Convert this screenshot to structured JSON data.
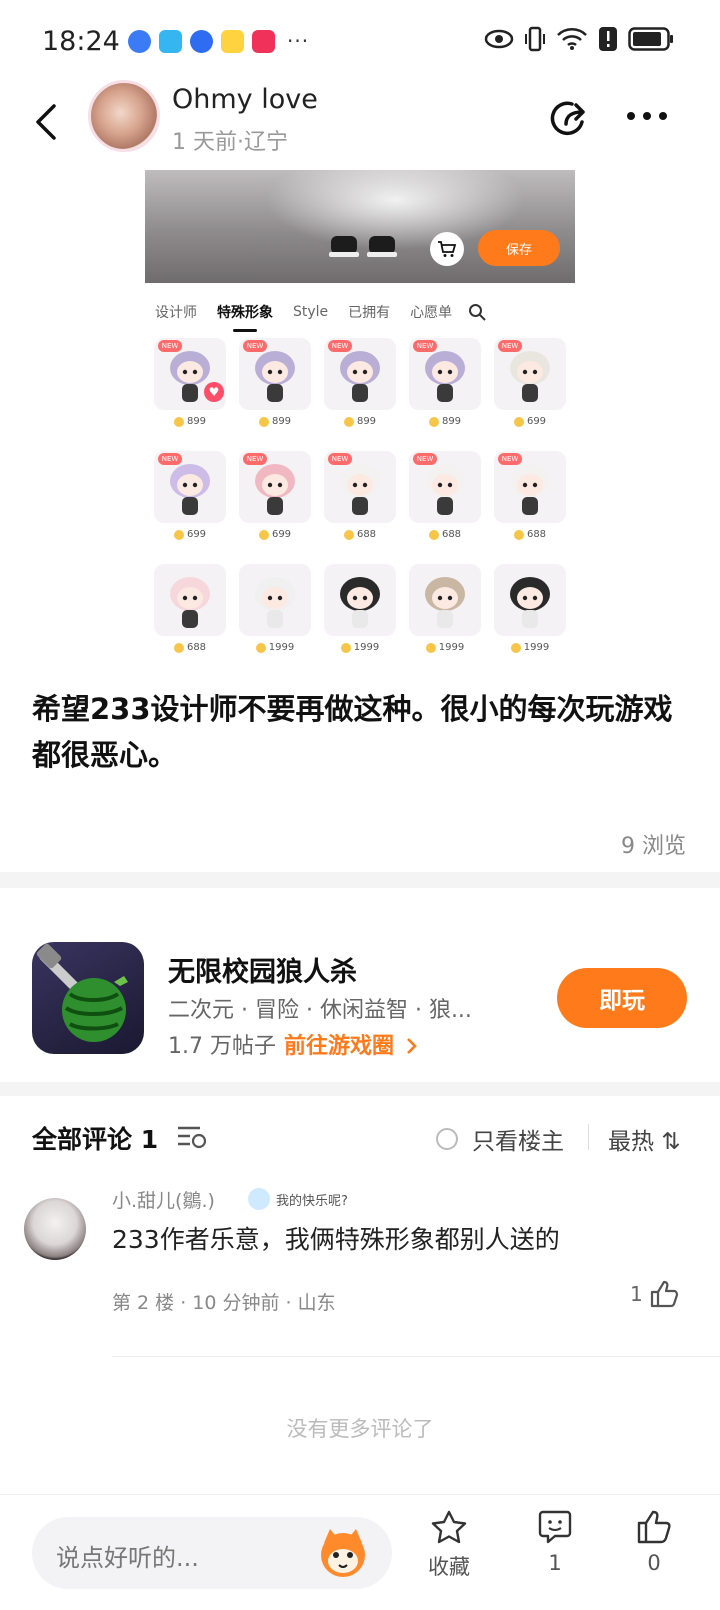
{
  "status_bar": {
    "time": "18:24",
    "more": "···"
  },
  "header": {
    "username": "Ohmy love",
    "meta": "1 天前·辽宁"
  },
  "post_image": {
    "save_label": "保存",
    "tabs": [
      "设计师",
      "特殊形象",
      "Style",
      "已拥有",
      "心愿单"
    ],
    "new_tag": "NEW",
    "items": [
      {
        "price": "899",
        "is_new": true
      },
      {
        "price": "899",
        "is_new": true
      },
      {
        "price": "899",
        "is_new": true
      },
      {
        "price": "899",
        "is_new": true
      },
      {
        "price": "699",
        "is_new": true
      },
      {
        "price": "699",
        "is_new": true
      },
      {
        "price": "699",
        "is_new": true
      },
      {
        "price": "688",
        "is_new": true
      },
      {
        "price": "688",
        "is_new": true
      },
      {
        "price": "688",
        "is_new": true
      },
      {
        "price": "688",
        "is_new": false
      },
      {
        "price": "1999",
        "is_new": false
      },
      {
        "price": "1999",
        "is_new": false
      },
      {
        "price": "1999",
        "is_new": false
      },
      {
        "price": "1999",
        "is_new": false
      }
    ]
  },
  "post": {
    "text": "希望233设计师不要再做这种。很小的每次玩游戏都很恶心。",
    "views": "9 浏览"
  },
  "game": {
    "title": "无限校园狼人杀",
    "tags": "二次元 · 冒险 · 休闲益智 · 狼...",
    "posts": "1.7 万帖子",
    "link": "前往游戏圈",
    "play_label": "即玩"
  },
  "comments_header": {
    "title": "全部评论 1",
    "only_op": "只看楼主",
    "sort": "最热 ⇅"
  },
  "comment": {
    "name": "小.甜儿(鶵.)",
    "badge_text": "我的快乐呢?",
    "text": "233作者乐意，我俩特殊形象都别人送的",
    "meta": "第 2 楼 · 10 分钟前 · 山东",
    "likes": "1"
  },
  "no_more": "没有更多评论了",
  "bottom_bar": {
    "input_placeholder": "说点好听的...",
    "favorite_label": "收藏",
    "comment_count": "1",
    "like_count": "0"
  },
  "colors": {
    "accent": "#ff7a1a",
    "divider": "#f4f4f4",
    "muted": "#888888"
  }
}
